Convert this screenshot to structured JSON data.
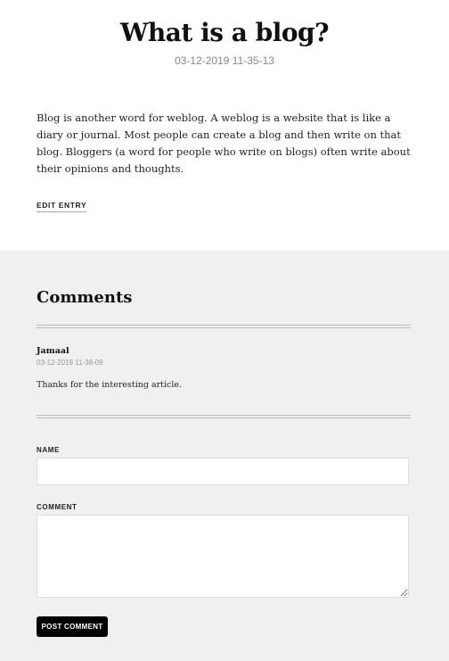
{
  "post": {
    "title": "What is a blog?",
    "date": "03-12-2019 11-35-13",
    "body": "Blog is another word for weblog. A weblog is a website that is like a diary or journal. Most people can create a blog and then write on that blog. Bloggers (a word for people who write on blogs) often write about their opinions and thoughts.",
    "edit_label": "EDIT ENTRY"
  },
  "comments": {
    "heading": "Comments",
    "items": [
      {
        "author": "Jamaal",
        "date": "03-12-2019 11-38-09",
        "text": "Thanks for the interesting article."
      }
    ]
  },
  "form": {
    "name_label": "NAME",
    "name_value": "",
    "comment_label": "COMMENT",
    "comment_value": "",
    "submit_label": "POST COMMENT"
  }
}
